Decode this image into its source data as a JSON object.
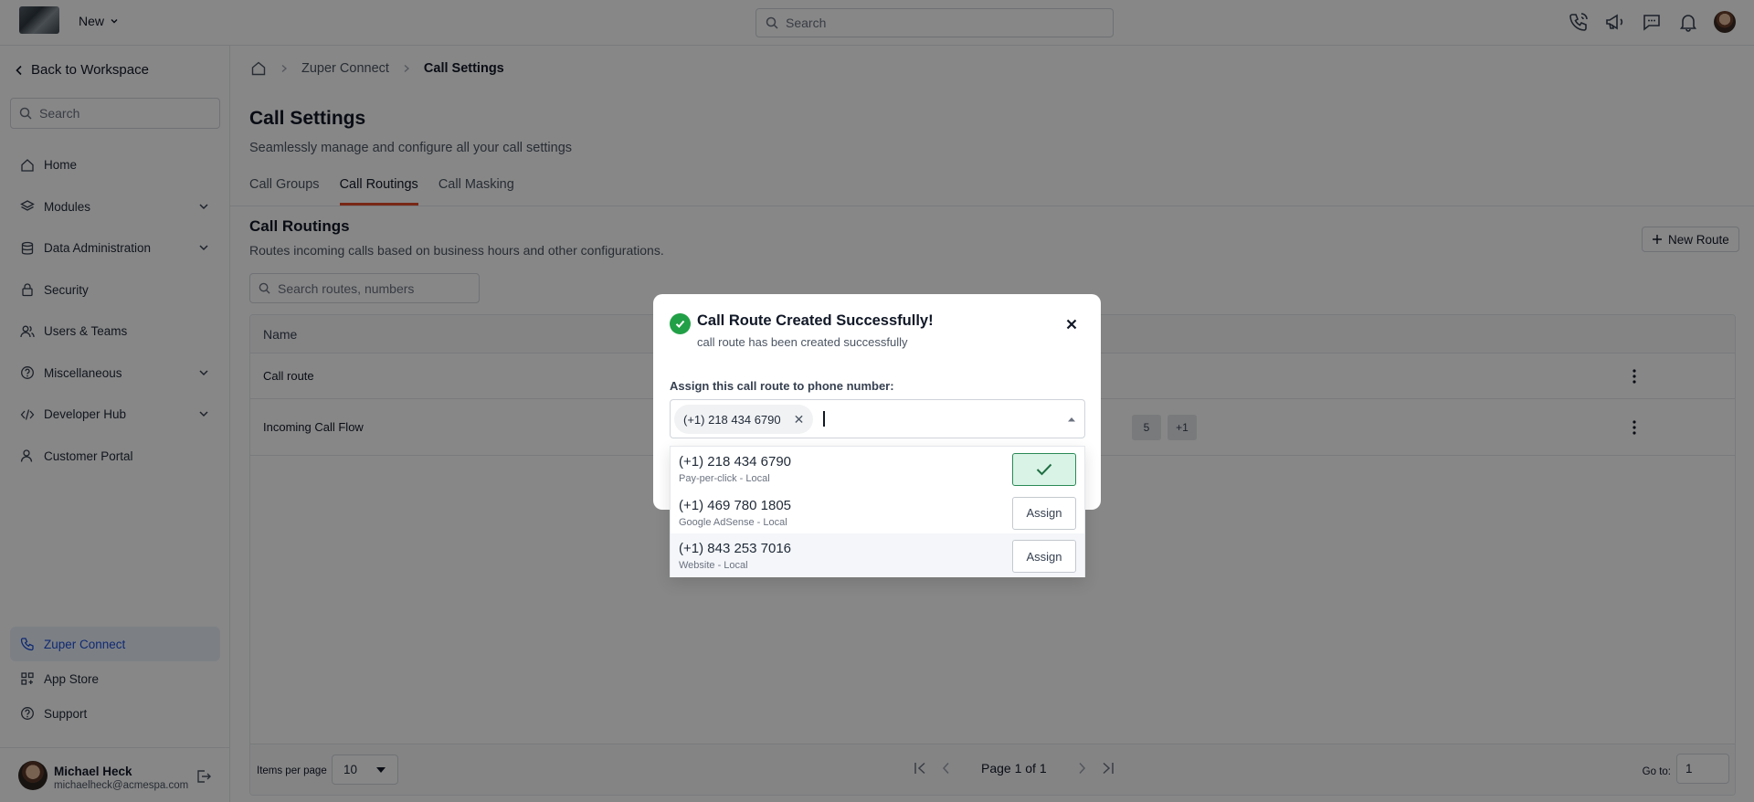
{
  "topbar": {
    "new_label": "New",
    "search_placeholder": "Search"
  },
  "sidebar": {
    "back_label": "Back to Workspace",
    "search_placeholder": "Search",
    "items": [
      {
        "label": "Home",
        "icon": "home-icon"
      },
      {
        "label": "Modules",
        "icon": "layers-icon"
      },
      {
        "label": "Data Administration",
        "icon": "database-icon"
      },
      {
        "label": "Security",
        "icon": "lock-icon"
      },
      {
        "label": "Users & Teams",
        "icon": "users-icon"
      },
      {
        "label": "Miscellaneous",
        "icon": "help-circle-icon"
      },
      {
        "label": "Developer Hub",
        "icon": "code-icon"
      },
      {
        "label": "Customer Portal",
        "icon": "user-icon"
      }
    ],
    "bottom_items": [
      {
        "label": "Zuper Connect",
        "icon": "phone-icon"
      },
      {
        "label": "App Store",
        "icon": "grid-icon"
      },
      {
        "label": "Support",
        "icon": "help-circle-icon"
      }
    ],
    "user": {
      "name": "Michael Heck",
      "email": "michaelheck@acmespa.com"
    }
  },
  "main": {
    "breadcrumb": [
      "Zuper Connect",
      "Call Settings"
    ],
    "title": "Call Settings",
    "subtitle": "Seamlessly manage and configure all your call settings",
    "tabs": [
      "Call Groups",
      "Call Routings",
      "Call Masking"
    ],
    "active_tab": "Call Routings",
    "section_title": "Call Routings",
    "section_subtitle": "Routes incoming calls based on business hours and other configurations.",
    "new_route_label": "New Route",
    "routes_search_placeholder": "Search routes, numbers",
    "table": {
      "header_name": "Name",
      "rows": [
        {
          "name": "Call route"
        },
        {
          "name": "Incoming Call Flow",
          "chip_partial": "5",
          "chip_more": "+1"
        }
      ]
    },
    "footer": {
      "items_per_page_label": "Items per page",
      "items_per_page_value": "10",
      "page_text": "Page 1 of 1",
      "goto_label": "Go to:",
      "goto_value": "1"
    }
  },
  "modal": {
    "title": "Call Route Created Successfully!",
    "subtitle": "call route has been created successfully",
    "assign_label": "Assign this call route to phone number:",
    "selected_tag": "(+1) 218 434 6790",
    "options": [
      {
        "number": "(+1) 218 434 6790",
        "source": "Pay-per-click - Local",
        "assigned": true
      },
      {
        "number": "(+1) 469 780 1805",
        "source": "Google AdSense - Local",
        "assigned": false,
        "button": "Assign"
      },
      {
        "number": "(+1) 843 253 7016",
        "source": "Website - Local",
        "assigned": false,
        "button": "Assign"
      }
    ]
  },
  "colors": {
    "accent_tab": "#e24b2b",
    "success": "#22a047",
    "active_nav_bg": "#eaf1fb"
  }
}
